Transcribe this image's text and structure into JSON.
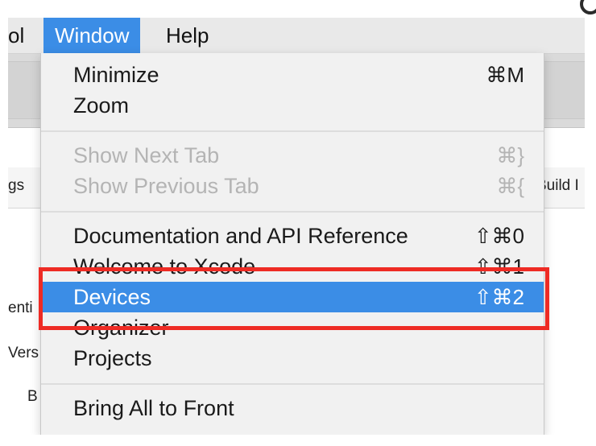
{
  "menubar": {
    "items": [
      {
        "label": "ol"
      },
      {
        "label": "Window"
      },
      {
        "label": "Help"
      }
    ]
  },
  "background": {
    "fragments": {
      "left_tab": "gs",
      "right_tab": "Build I",
      "label1": "enti",
      "label2": "Vers",
      "label3": "B"
    }
  },
  "window_menu": {
    "items": [
      {
        "label": "Minimize",
        "shortcut": "⌘M"
      },
      {
        "label": "Zoom",
        "shortcut": ""
      },
      {
        "label": "Show Next Tab",
        "shortcut": "⌘}"
      },
      {
        "label": "Show Previous Tab",
        "shortcut": "⌘{"
      },
      {
        "label": "Documentation and API Reference",
        "shortcut": "⇧⌘0"
      },
      {
        "label": "Welcome to Xcode",
        "shortcut": "⇧⌘1"
      },
      {
        "label": "Devices",
        "shortcut": "⇧⌘2"
      },
      {
        "label": "Organizer",
        "shortcut": ""
      },
      {
        "label": "Projects",
        "shortcut": ""
      },
      {
        "label": "Bring All to Front",
        "shortcut": ""
      }
    ]
  },
  "colors": {
    "highlight": "#3b8de6",
    "annotation": "#ee2b24",
    "menu_bg": "#f1f1f1"
  }
}
